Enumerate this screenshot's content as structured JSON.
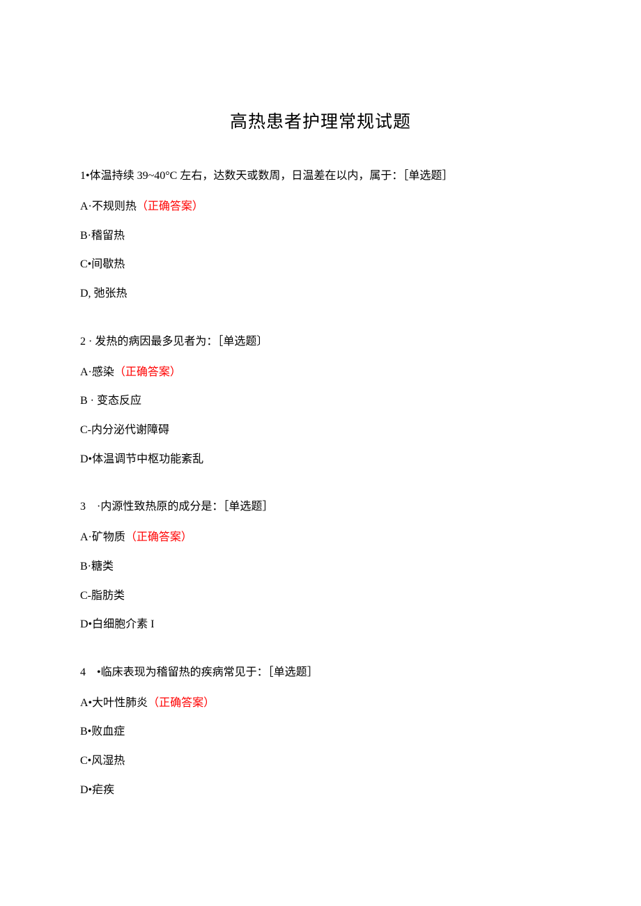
{
  "title": "高热患者护理常规试题",
  "questions": [
    {
      "stem": "1•体温持续 39~40°C 左右，达数天或数周，日温差在以内，属于：［单选题］",
      "options": [
        {
          "text": "A·不规则热",
          "correctLabel": "（正确答案）"
        },
        {
          "text": "B·稽留热",
          "correctLabel": ""
        },
        {
          "text": "C•间歇热",
          "correctLabel": ""
        },
        {
          "text": "D, 弛张热",
          "correctLabel": ""
        }
      ]
    },
    {
      "stem": "2 · 发热的病因最多见者为：［单选题〕",
      "options": [
        {
          "text": "A·感染",
          "correctLabel": "（正确答案）"
        },
        {
          "text": "B · 变态反应",
          "correctLabel": ""
        },
        {
          "text": "C-内分泌代谢障碍",
          "correctLabel": ""
        },
        {
          "text": "D•体温调节中枢功能紊乱",
          "correctLabel": ""
        }
      ]
    },
    {
      "stem": "3　·内源性致热原的成分是：［单选题］",
      "options": [
        {
          "text": "A·矿物质",
          "correctLabel": "（正确答案）"
        },
        {
          "text": "B·糖类",
          "correctLabel": ""
        },
        {
          "text": "C-脂肪类",
          "correctLabel": ""
        },
        {
          "text": "D•白细胞介素 I",
          "correctLabel": ""
        }
      ]
    },
    {
      "stem": "4　•临床表现为稽留热的疾病常见于：［单选题］",
      "options": [
        {
          "text": "A•大叶性肺炎",
          "correctLabel": "（正确答案）"
        },
        {
          "text": "B•败血症",
          "correctLabel": ""
        },
        {
          "text": "C•风湿热",
          "correctLabel": ""
        },
        {
          "text": "D•疟疾",
          "correctLabel": ""
        }
      ]
    }
  ]
}
